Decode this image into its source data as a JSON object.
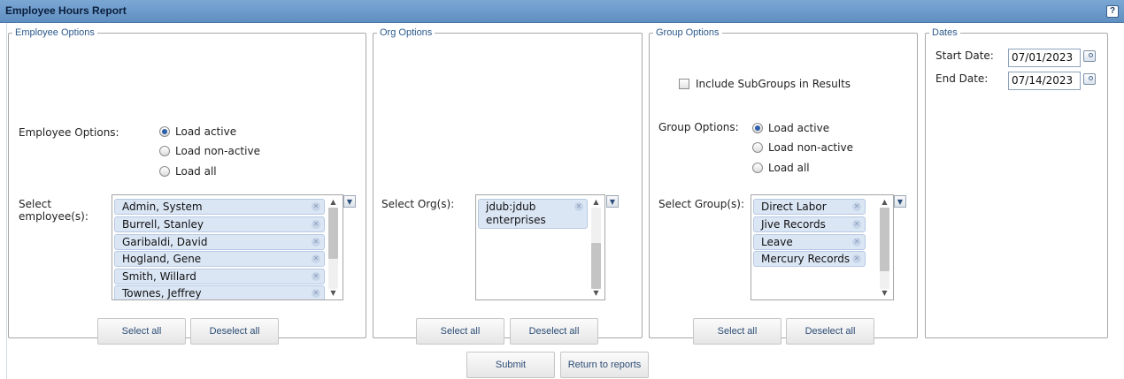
{
  "header": {
    "title": "Employee Hours Report",
    "help_label": "?"
  },
  "employee_panel": {
    "legend": "Employee Options",
    "options_label": "Employee Options:",
    "radios": [
      {
        "label": "Load active",
        "checked": true
      },
      {
        "label": "Load non-active",
        "checked": false
      },
      {
        "label": "Load all",
        "checked": false
      }
    ],
    "select_label": "Select employee(s):",
    "items": [
      "Admin, System",
      "Burrell, Stanley",
      "Garibaldi, David",
      "Hogland, Gene",
      "Smith, Willard",
      "Townes, Jeffrey"
    ],
    "select_all": "Select all",
    "deselect_all": "Deselect all"
  },
  "org_panel": {
    "legend": "Org Options",
    "select_label": "Select Org(s):",
    "items": [
      "jdub:jdub enterprises"
    ],
    "select_all": "Select all",
    "deselect_all": "Deselect all"
  },
  "group_panel": {
    "legend": "Group Options",
    "include_subgroups_label": "Include SubGroups in Results",
    "include_subgroups_checked": false,
    "options_label": "Group Options:",
    "radios": [
      {
        "label": "Load active",
        "checked": true
      },
      {
        "label": "Load non-active",
        "checked": false
      },
      {
        "label": "Load all",
        "checked": false
      }
    ],
    "select_label": "Select Group(s):",
    "items": [
      "Direct Labor",
      "Jive Records",
      "Leave",
      "Mercury Records"
    ],
    "select_all": "Select all",
    "deselect_all": "Deselect all"
  },
  "dates_panel": {
    "legend": "Dates",
    "start_label": "Start Date:",
    "start_value": "07/01/2023",
    "end_label": "End Date:",
    "end_value": "07/14/2023"
  },
  "footer": {
    "submit": "Submit",
    "return": "Return to reports"
  },
  "icons": {
    "remove": "close-icon",
    "calendar": "calendar-icon",
    "dropdown": "chevron-down-icon"
  },
  "colors": {
    "title_bar": "#6f9ccd",
    "legend": "#2c5a8c",
    "chip": "#dbe6f5",
    "radio_selected": "#2d5fa8"
  }
}
